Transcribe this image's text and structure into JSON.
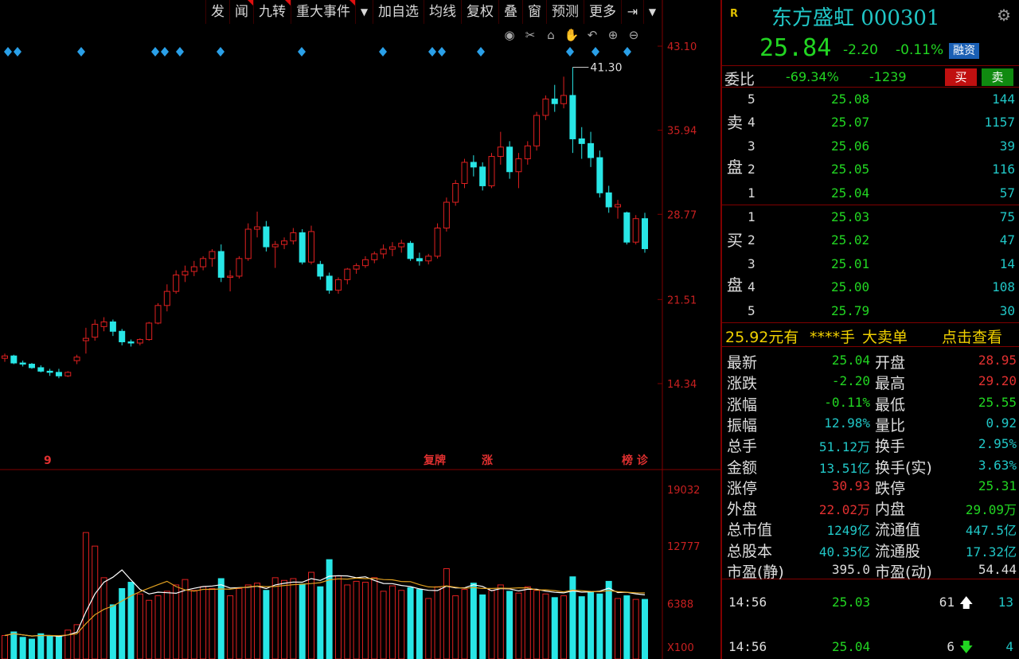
{
  "toolbar": {
    "items": [
      "发",
      "闻",
      "九转",
      "重大事件",
      "加自选",
      "均线",
      "复权",
      "叠",
      "窗",
      "预测",
      "更多"
    ]
  },
  "chart_icons": [
    "eye-icon",
    "scissors-icon",
    "lock-icon",
    "hand-icon",
    "undo-icon",
    "zoom-in-icon",
    "zoom-out-icon"
  ],
  "chart_data": [
    {
      "type": "candlestick",
      "y_axis_ticks": [
        "43.10",
        "35.94",
        "28.77",
        "21.51",
        "14.34"
      ],
      "ylim": [
        14.34,
        43.1
      ],
      "high_label": "41.30",
      "event_markers": [
        "9",
        "复牌",
        "涨",
        "榜 诊"
      ],
      "candles": [
        [
          16.5,
          16.9,
          16.2,
          16.7
        ],
        [
          16.7,
          16.8,
          16.0,
          16.1
        ],
        [
          16.1,
          16.3,
          15.8,
          16.0
        ],
        [
          16.0,
          16.1,
          15.6,
          15.7
        ],
        [
          15.7,
          15.9,
          15.3,
          15.4
        ],
        [
          15.4,
          15.6,
          15.0,
          15.3
        ],
        [
          15.3,
          15.6,
          14.8,
          15.0
        ],
        [
          15.0,
          15.4,
          14.9,
          15.3
        ],
        [
          16.3,
          16.8,
          16.0,
          16.6
        ],
        [
          18.0,
          19.1,
          16.9,
          18.2
        ],
        [
          18.3,
          19.8,
          18.0,
          19.4
        ],
        [
          19.2,
          20.0,
          18.8,
          19.6
        ],
        [
          19.6,
          19.8,
          18.4,
          18.8
        ],
        [
          18.8,
          19.0,
          17.6,
          17.9
        ],
        [
          17.9,
          18.1,
          17.5,
          17.8
        ],
        [
          17.8,
          18.2,
          17.6,
          18.1
        ],
        [
          18.1,
          19.6,
          18.0,
          19.5
        ],
        [
          19.5,
          21.2,
          19.4,
          21.0
        ],
        [
          21.0,
          22.8,
          20.5,
          22.2
        ],
        [
          22.2,
          24.0,
          22.0,
          23.6
        ],
        [
          23.6,
          24.4,
          23.0,
          23.9
        ],
        [
          23.9,
          24.8,
          23.5,
          24.3
        ],
        [
          24.3,
          25.2,
          24.0,
          25.0
        ],
        [
          25.0,
          25.8,
          24.3,
          25.6
        ],
        [
          25.6,
          26.2,
          23.0,
          23.4
        ],
        [
          23.4,
          24.0,
          22.2,
          23.5
        ],
        [
          23.5,
          25.2,
          23.3,
          25.0
        ],
        [
          25.0,
          28.0,
          24.8,
          27.5
        ],
        [
          27.5,
          29.0,
          26.8,
          27.7
        ],
        [
          27.7,
          28.2,
          25.6,
          26.0
        ],
        [
          26.0,
          26.5,
          24.2,
          26.2
        ],
        [
          26.2,
          26.8,
          25.8,
          26.5
        ],
        [
          26.5,
          27.6,
          26.2,
          27.2
        ],
        [
          27.2,
          27.5,
          24.5,
          24.7
        ],
        [
          24.7,
          27.8,
          24.5,
          27.3
        ],
        [
          24.5,
          24.8,
          23.2,
          23.5
        ],
        [
          23.5,
          23.8,
          22.0,
          22.3
        ],
        [
          22.3,
          23.4,
          22.0,
          23.2
        ],
        [
          23.2,
          24.2,
          22.8,
          24.1
        ],
        [
          24.1,
          24.6,
          23.7,
          24.4
        ],
        [
          24.4,
          25.2,
          24.2,
          24.9
        ],
        [
          24.9,
          25.6,
          24.6,
          25.4
        ],
        [
          25.4,
          26.2,
          25.0,
          25.8
        ],
        [
          25.8,
          26.4,
          25.2,
          26.0
        ],
        [
          26.0,
          26.6,
          25.5,
          26.3
        ],
        [
          26.3,
          26.5,
          24.8,
          25.0
        ],
        [
          25.0,
          25.5,
          24.4,
          24.8
        ],
        [
          24.8,
          25.4,
          24.5,
          25.2
        ],
        [
          25.2,
          28.0,
          25.0,
          27.6
        ],
        [
          27.6,
          30.2,
          27.3,
          29.8
        ],
        [
          29.8,
          31.7,
          29.5,
          31.4
        ],
        [
          31.4,
          33.5,
          31.0,
          33.2
        ],
        [
          33.2,
          33.8,
          32.0,
          32.8
        ],
        [
          32.8,
          33.2,
          30.8,
          31.2
        ],
        [
          31.2,
          34.0,
          31.0,
          33.7
        ],
        [
          33.7,
          35.8,
          33.0,
          34.5
        ],
        [
          34.5,
          35.0,
          31.8,
          32.4
        ],
        [
          32.4,
          34.0,
          31.0,
          33.5
        ],
        [
          33.5,
          35.0,
          33.0,
          34.6
        ],
        [
          34.6,
          37.5,
          34.2,
          37.2
        ],
        [
          37.2,
          38.9,
          36.8,
          38.6
        ],
        [
          38.6,
          39.8,
          37.5,
          38.2
        ],
        [
          38.2,
          40.5,
          37.8,
          38.9
        ],
        [
          38.9,
          41.3,
          34.0,
          35.2
        ],
        [
          35.2,
          36.2,
          33.5,
          34.8
        ],
        [
          34.8,
          35.8,
          32.8,
          33.6
        ],
        [
          33.6,
          34.2,
          30.2,
          30.6
        ],
        [
          30.6,
          31.2,
          28.9,
          29.4
        ],
        [
          29.4,
          30.0,
          28.4,
          29.6
        ],
        [
          28.9,
          29.0,
          26.2,
          26.4
        ],
        [
          26.4,
          28.7,
          26.2,
          28.4
        ],
        [
          28.4,
          28.9,
          25.5,
          25.84
        ]
      ]
    },
    {
      "type": "bar",
      "y_axis_ticks": [
        "19032",
        "12777",
        "6388",
        "X100"
      ],
      "ylim": [
        0,
        19032
      ],
      "values": [
        2600,
        3000,
        2400,
        2200,
        2800,
        2600,
        2500,
        3200,
        3800,
        14000,
        12500,
        9000,
        6000,
        7800,
        8500,
        7200,
        6500,
        7000,
        7500,
        8200,
        8800,
        7600,
        8000,
        7800,
        8900,
        7000,
        7800,
        8200,
        8400,
        7600,
        9000,
        8700,
        8900,
        8300,
        9600,
        8000,
        11000,
        9200,
        8200,
        8600,
        8500,
        9000,
        7500,
        8100,
        7600,
        7900,
        7700,
        6700,
        8000,
        10000,
        7000,
        7700,
        8400,
        7100,
        7600,
        8200,
        7500,
        7300,
        8000,
        7600,
        7200,
        6800,
        7000,
        9100,
        6900,
        7400,
        7200,
        8600,
        6700,
        7000,
        6600,
        6600
      ]
    }
  ],
  "stock": {
    "badge": "R",
    "title": "东方盛虹 000301",
    "price": "25.84",
    "change": "-2.20",
    "change_pct": "-0.11%",
    "rz_badge": "融资"
  },
  "wb": {
    "label": "委比",
    "pct": "-69.34%",
    "diff": "-1239",
    "buy": "买",
    "sell": "卖"
  },
  "order_book": {
    "sell_label": [
      "卖",
      "盘"
    ],
    "buy_label": [
      "买",
      "盘"
    ],
    "sell": [
      {
        "lvl": "5",
        "price": "25.08",
        "vol": "144"
      },
      {
        "lvl": "4",
        "price": "25.07",
        "vol": "1157"
      },
      {
        "lvl": "3",
        "price": "25.06",
        "vol": "39"
      },
      {
        "lvl": "2",
        "price": "25.05",
        "vol": "116"
      },
      {
        "lvl": "1",
        "price": "25.04",
        "vol": "57"
      }
    ],
    "buy": [
      {
        "lvl": "1",
        "price": "25.03",
        "vol": "75"
      },
      {
        "lvl": "2",
        "price": "25.02",
        "vol": "47"
      },
      {
        "lvl": "3",
        "price": "25.01",
        "vol": "14"
      },
      {
        "lvl": "4",
        "price": "25.00",
        "vol": "108"
      },
      {
        "lvl": "5",
        "price": "25.79",
        "vol": "30"
      }
    ]
  },
  "big_order": {
    "price": "25.92元有",
    "hands": "****手",
    "type": "大卖单",
    "link": "点击查看"
  },
  "stats": [
    {
      "l": "最新",
      "lv": "25.04",
      "lc": "green",
      "r": "开盘",
      "rv": "28.95",
      "rc": "red"
    },
    {
      "l": "涨跌",
      "lv": "-2.20",
      "lc": "green",
      "r": "最高",
      "rv": "29.20",
      "rc": "red"
    },
    {
      "l": "涨幅",
      "lv": "-0.11%",
      "lc": "green",
      "r": "最低",
      "rv": "25.55",
      "rc": "green"
    },
    {
      "l": "振幅",
      "lv": "12.98%",
      "lc": "cyan",
      "r": "量比",
      "rv": "0.92",
      "rc": "cyan"
    },
    {
      "l": "总手",
      "lv": "51.12万",
      "lc": "cyan",
      "r": "换手",
      "rv": "2.95%",
      "rc": "cyan"
    },
    {
      "l": "金额",
      "lv": "13.51亿",
      "lc": "cyan",
      "r": "换手(实)",
      "rv": "3.63%",
      "rc": "cyan"
    },
    {
      "l": "涨停",
      "lv": "30.93",
      "lc": "red",
      "r": "跌停",
      "rv": "25.31",
      "rc": "green"
    },
    {
      "l": "外盘",
      "lv": "22.02万",
      "lc": "red",
      "r": "内盘",
      "rv": "29.09万",
      "rc": "green"
    },
    {
      "l": "总市值",
      "lv": "1249亿",
      "lc": "cyan",
      "r": "流通值",
      "rv": "447.5亿",
      "rc": "cyan"
    },
    {
      "l": "总股本",
      "lv": "40.35亿",
      "lc": "cyan",
      "r": "流通股",
      "rv": "17.32亿",
      "rc": "cyan"
    },
    {
      "l": "市盈(静)",
      "lv": "395.0",
      "lc": "white",
      "r": "市盈(动)",
      "rv": "54.44",
      "rc": "white"
    }
  ],
  "ticks": [
    {
      "time": "14:56",
      "price": "25.03",
      "vol": "61",
      "dir": "up",
      "n": "13"
    },
    {
      "time": "14:56",
      "price": "25.04",
      "vol": "6",
      "dir": "down",
      "n": "4"
    }
  ],
  "colors": {
    "up": "#e02020",
    "down": "#28e6e6",
    "bg": "#000000",
    "grid": "#800000"
  }
}
